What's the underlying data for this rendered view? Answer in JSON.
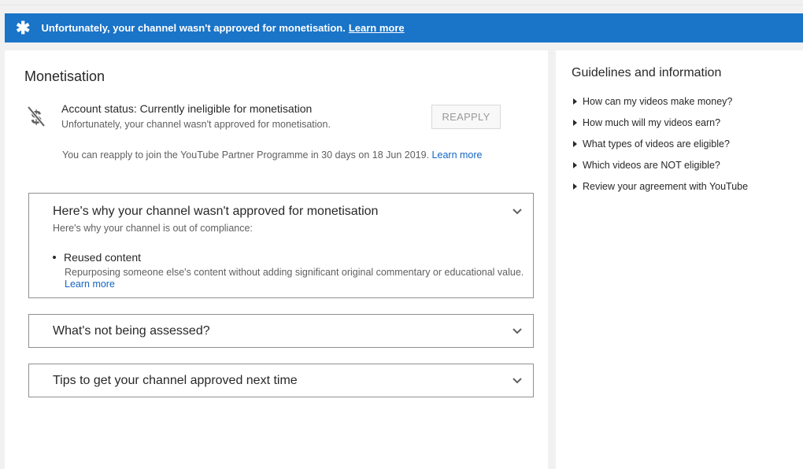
{
  "banner": {
    "icon": "star-icon",
    "message": "Unfortunately, your channel wasn't approved for monetisation.",
    "link": "Learn more",
    "color": "#1a74c8"
  },
  "main": {
    "title": "Monetisation",
    "status": {
      "icon": "no-dollar-icon",
      "heading": "Account status: Currently ineligible for monetisation",
      "subtext": "Unfortunately, your channel wasn't approved for monetisation.",
      "button": "REAPPLY",
      "reapply_text": "You can reapply to join the YouTube Partner Programme in 30 days on 18 Jun 2019.",
      "reapply_link": "Learn more"
    },
    "panels": [
      {
        "title": "Here's why your channel wasn't approved for monetisation",
        "subtitle": "Here's why your channel is out of compliance:",
        "item_title": "Reused content",
        "item_desc": "Repurposing someone else's content without adding significant original commentary or educational value.",
        "item_link": "Learn more"
      },
      {
        "title": "What's not being assessed?"
      },
      {
        "title": "Tips to get your channel approved next time"
      }
    ]
  },
  "sidebar": {
    "title": "Guidelines and information",
    "items": [
      "How can my videos make money?",
      "How much will my videos earn?",
      "What types of videos are eligible?",
      "Which videos are NOT eligible?",
      "Review your agreement with YouTube"
    ]
  }
}
